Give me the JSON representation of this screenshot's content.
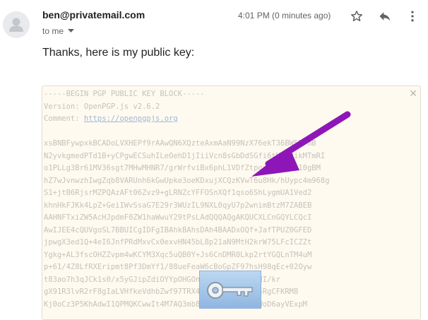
{
  "email": {
    "sender": "ben@privatemail.com",
    "recipient_label": "to me",
    "timestamp": "4:01 PM (0 minutes ago)",
    "body_text": "Thanks, here is my public key:"
  },
  "header_icons": [
    "star-icon",
    "reply-icon",
    "more-vert-icon"
  ],
  "pgp_key": {
    "lines": [
      "-----BEGIN PGP PUBLIC KEY BLOCK-----",
      "Version: OpenPGP.js v2.6.2",
      "Comment: ",
      "",
      "xsBNBFywpxkBCADoLVXHEPf9rAAwQN6XQzteAxmAaN99NzX76ekT36BWSDrmB",
      "N2yvkgmedPTd1B+yCPgwECSuhILeOehD1jIiiVcn8sGbDdSGfi6tMNi9ikMTmRI",
      "o1PLLg3Br61MV36sgt7MHwMHNR7/grWrfviBx6phL1VDfZtpoq7FBEvBh10gBM",
      "hZ7wJvnwzhIwgZqb8VARUnh6kGwUpke3oeKDxujXCQzKVwT6u8Hk/hUypc4m968g",
      "S1+jtB6RjsrMZPQAzAFt06Zvz9+gLRNZcYFFOSnXQf1qso6ShLygmUA1Ved2",
      "khnHkFJKk4LpZ+GeiIWvSsaG7E29r3WUzIL9NXL0qyU7p2wnimBtzM7ZABEB",
      "AAHNFTxiZW5AcHJpdmF0ZW1haWwuY29tPsLAdQQQAQgAKQUCXLCnGQYLCQcI",
      "AwIJEE4cQUVgoSL7BBUICgIDFgIBAhkBAhsDAh4BAADxOQf+JafTPUZ0GFED",
      "jpwgX3ed1Q+4eI6JnfPRdMxvCx0exvHN45bL8p21aN9MtH2krW75LFcICZZt",
      "Ygkg+AL3fscOHZZvpm4wKCYM3Xqc5uQB0Y+Js6CnDMR0Lkp2rtYGQLnTM4uM",
      "p+61/4Z8LfRXEripmt8Pf3DmYf1/88ueFeaW6cBoGpZF97hsH98qEc+02Oyw",
      "t83ao7h3qJCk1s0/x5yGJipZdiOYYpOHGOn8NXw9We9I0fKedI/kr",
      "gX91R3lvR2rF8gIaLVHfkeVdhbZwf97TRX4/pnQqZnOmq3ty4RgCFKRM8",
      "Kj0oCz3P5KhAdwI1QPMQKCwwIt4M7AQ3mb8hxxjqwZAOuz4pWoD6ayVExpM"
    ],
    "comment_link": "https://openpgpjs.org"
  }
}
